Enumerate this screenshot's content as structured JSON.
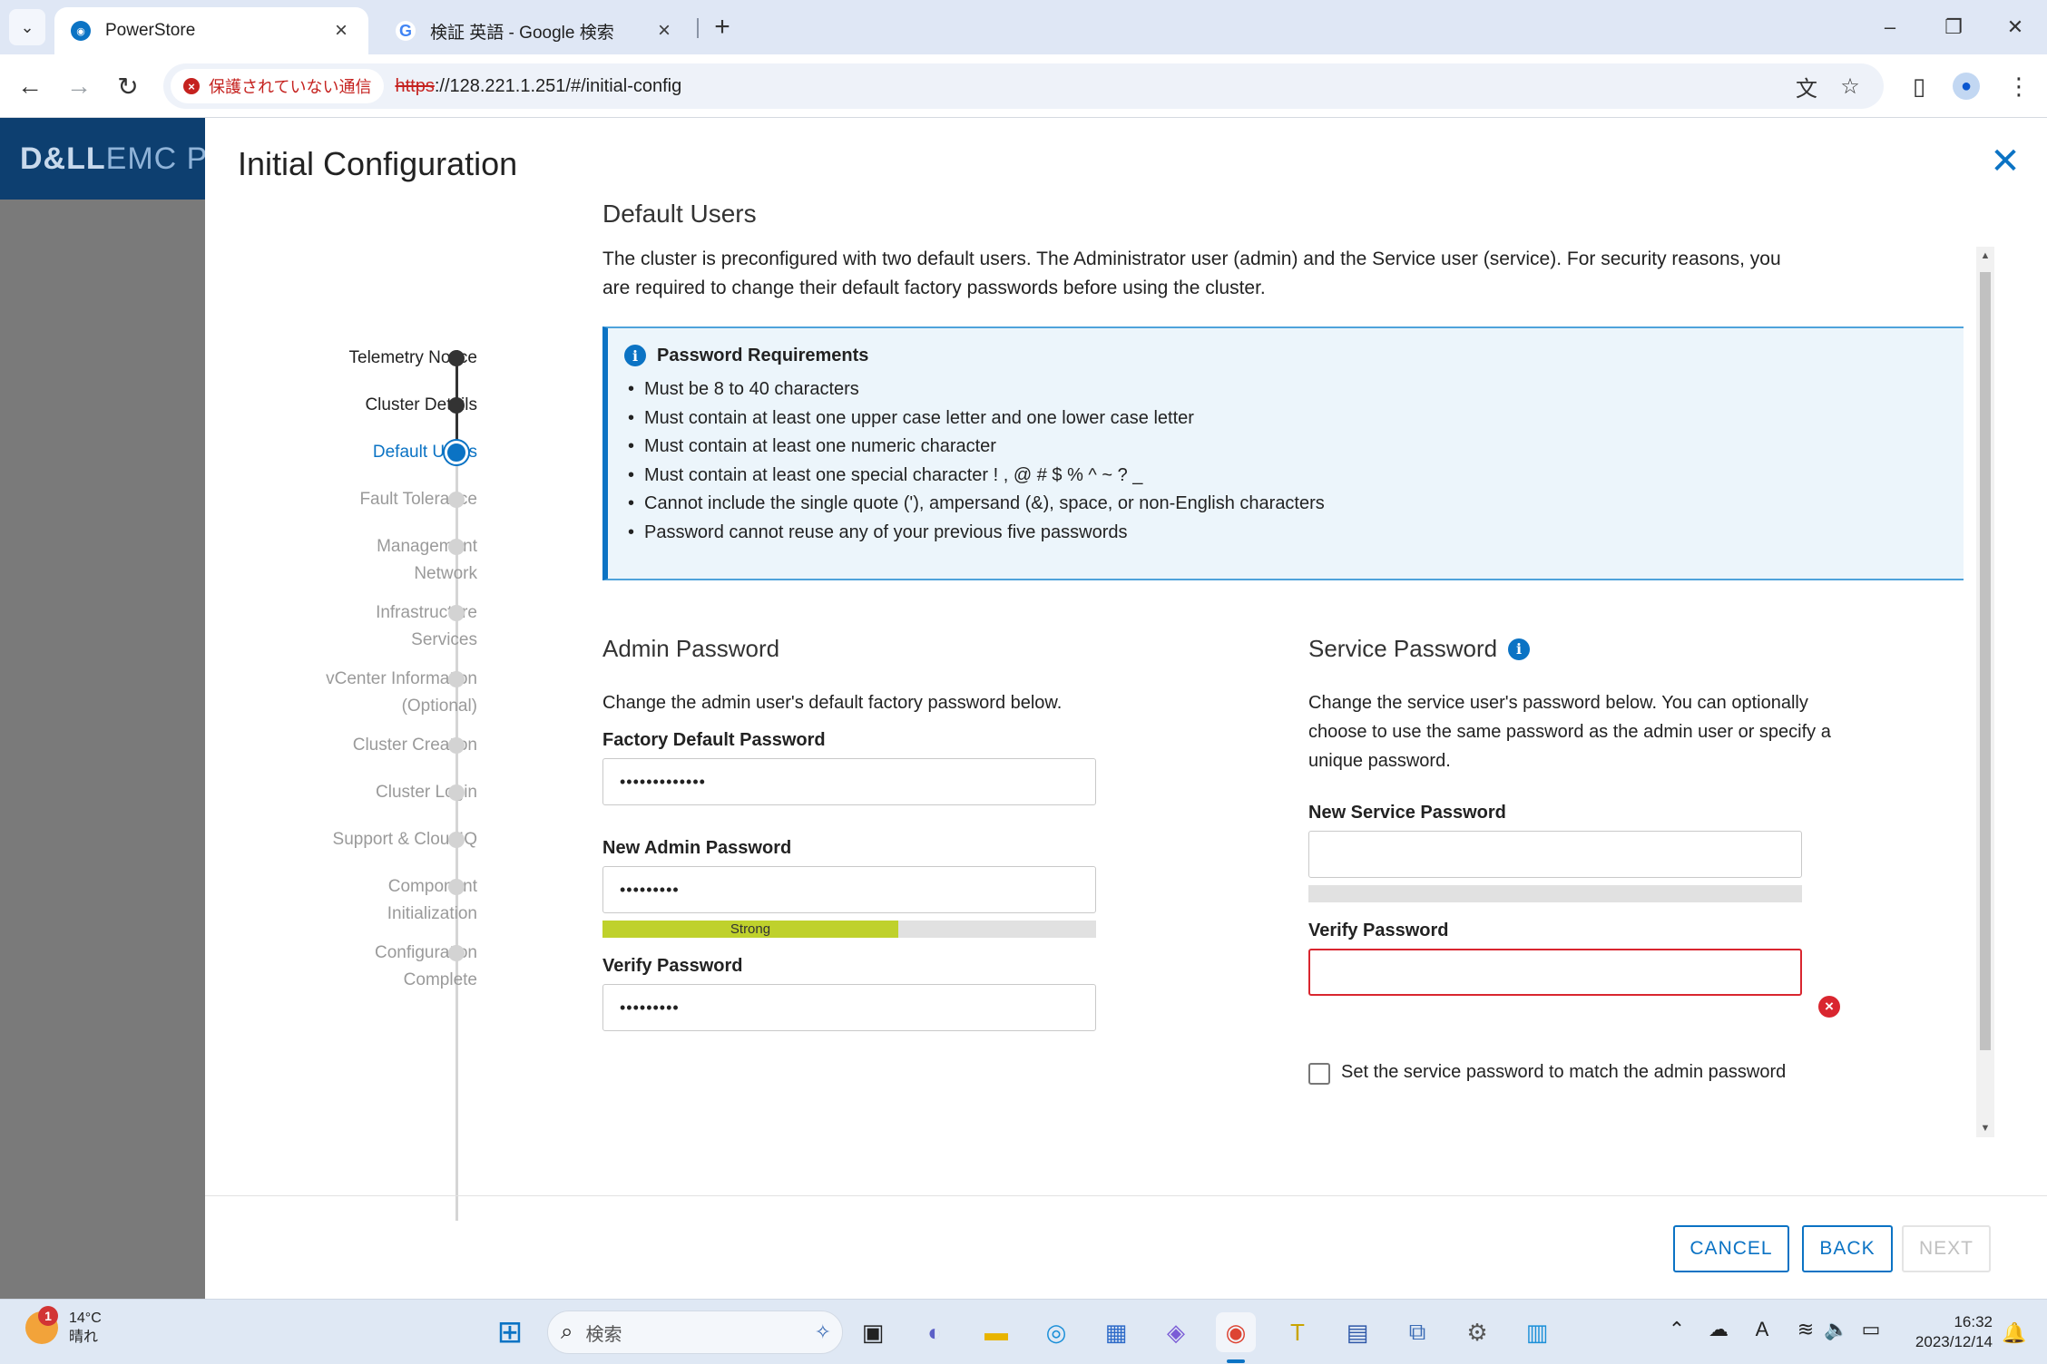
{
  "browser": {
    "tabs": [
      {
        "title": "PowerStore",
        "active": true
      },
      {
        "title": "検証 英語 - Google 検索",
        "active": false
      }
    ],
    "security_label": "保護されていない通信",
    "url_scheme": "https",
    "url_rest": "://128.221.1.251/#/initial-config"
  },
  "app": {
    "brand_a": "D&LL",
    "brand_b": "EMC P"
  },
  "modal": {
    "title": "Initial Configuration",
    "steps": [
      {
        "label": "Telemetry Notice",
        "state": "done"
      },
      {
        "label": "Cluster Details",
        "state": "done"
      },
      {
        "label": "Default Users",
        "state": "current"
      },
      {
        "label": "Fault Tolerance",
        "state": "pending"
      },
      {
        "label": "Management Network",
        "state": "pending"
      },
      {
        "label": "Infrastructure Services",
        "state": "pending"
      },
      {
        "label": "vCenter Information (Optional)",
        "state": "pending"
      },
      {
        "label": "Cluster Creation",
        "state": "pending"
      },
      {
        "label": "Cluster Login",
        "state": "pending"
      },
      {
        "label": "Support & CloudIQ",
        "state": "pending"
      },
      {
        "label": "Component Initialization",
        "state": "pending"
      },
      {
        "label": "Configuration Complete",
        "state": "pending"
      }
    ],
    "section_title": "Default Users",
    "intro": "The cluster is preconfigured with two default users. The Administrator user (admin) and the Service user (service). For security reasons, you are required to change their default factory passwords before using the cluster.",
    "requirements": {
      "title": "Password Requirements",
      "items": [
        "Must be 8 to 40 characters",
        "Must contain at least one upper case letter and one lower case letter",
        "Must contain at least one numeric character",
        "Must contain at least one special character ! , @ # $ % ^ ~ ? _",
        "Cannot include the single quote ('), ampersand (&), space, or non-English characters",
        "Password cannot reuse any of your previous five passwords"
      ]
    },
    "admin": {
      "title": "Admin Password",
      "desc": "Change the admin user's default factory password below.",
      "factory_label": "Factory Default Password",
      "factory_value": "•••••••••••••",
      "new_label": "New Admin Password",
      "new_value": "•••••••••",
      "strength_label": "Strong",
      "strength_fraction": 0.6,
      "verify_label": "Verify Password",
      "verify_value": "•••••••••"
    },
    "service": {
      "title": "Service Password",
      "desc": "Change the service user's password below. You can optionally choose to use the same password as the admin user or specify a unique password.",
      "new_label": "New Service Password",
      "new_value": "",
      "verify_label": "Verify Password",
      "verify_value": "",
      "match_checkbox_label": "Set the service password to match the admin password",
      "match_checked": false
    },
    "buttons": {
      "cancel": "CANCEL",
      "back": "BACK",
      "next": "NEXT"
    }
  },
  "taskbar": {
    "weather_badge": "1",
    "temperature": "14°C",
    "condition": "晴れ",
    "search_placeholder": "検索",
    "time": "16:32",
    "date": "2023/12/14"
  },
  "colors": {
    "accent": "#0b73c4",
    "error": "#d9262f",
    "strength": "#bfd12c",
    "header": "#0d3f70"
  }
}
